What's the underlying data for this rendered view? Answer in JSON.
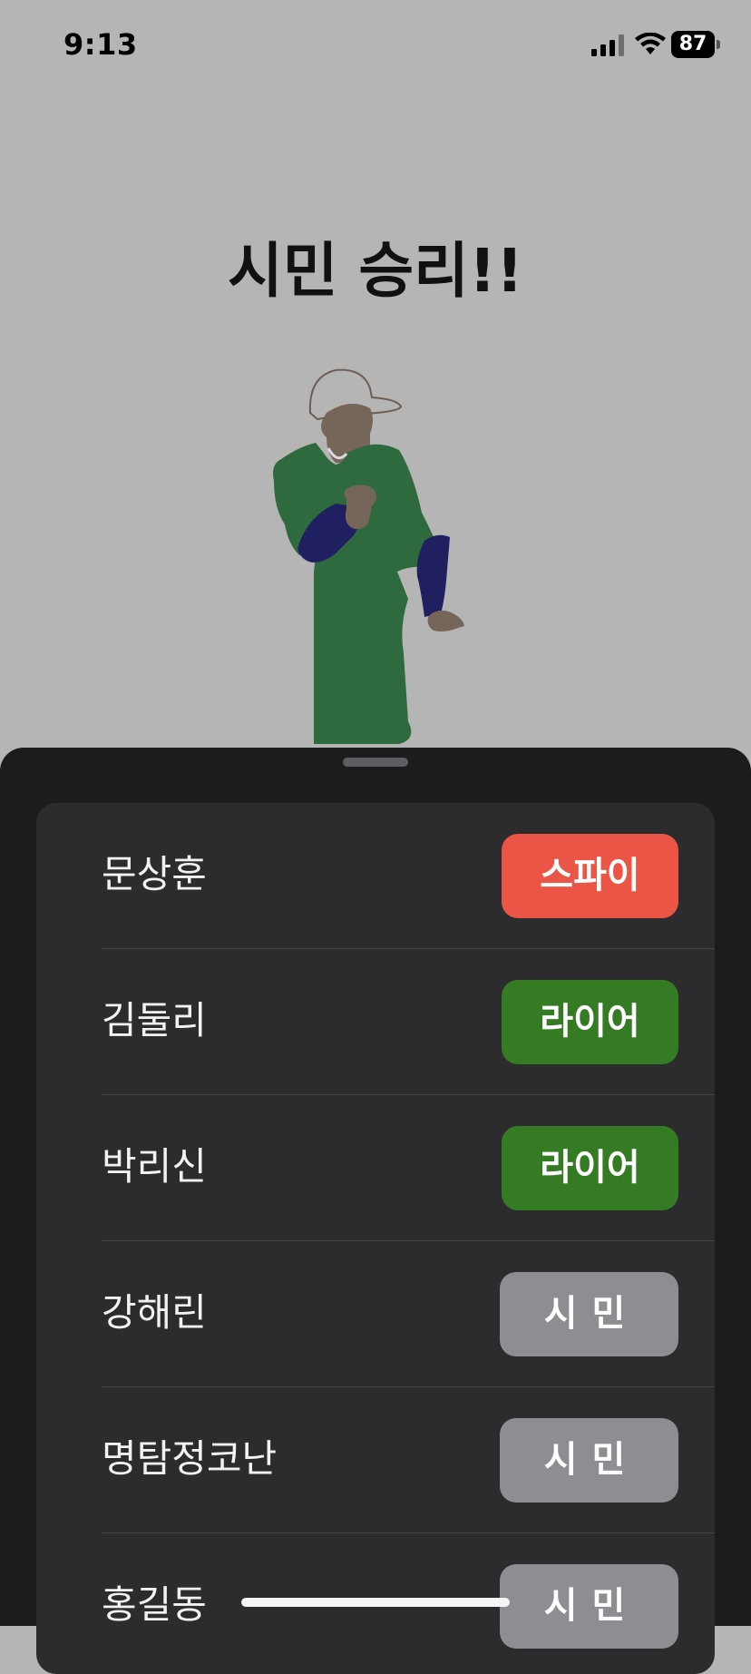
{
  "status_bar": {
    "time": "9:13",
    "battery_level": "87",
    "icons": [
      "signal-icon",
      "wifi-icon",
      "battery-icon"
    ]
  },
  "result": {
    "title": "시민 승리!!"
  },
  "players": [
    {
      "name": "문상훈",
      "role": "스파이",
      "role_color": "#eb5545"
    },
    {
      "name": "김둘리",
      "role": "라이어",
      "role_color": "#357b23"
    },
    {
      "name": "박리신",
      "role": "라이어",
      "role_color": "#357b23"
    },
    {
      "name": "강해린",
      "role": "시민",
      "role_color": "#8e8d92"
    },
    {
      "name": "명탐정코난",
      "role": "시민",
      "role_color": "#8e8d92"
    },
    {
      "name": "홍길동",
      "role": "시민",
      "role_color": "#8e8d92"
    }
  ],
  "colors": {
    "background": "#b5b5b5",
    "sheet": "#1c1c1e",
    "list": "#2c2c2e"
  }
}
